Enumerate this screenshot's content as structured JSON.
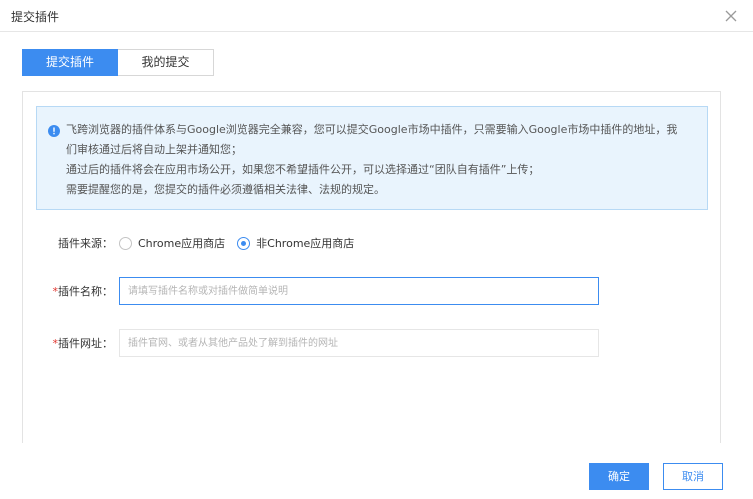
{
  "dialog": {
    "title": "提交插件"
  },
  "tabs": [
    {
      "label": "提交插件",
      "active": true
    },
    {
      "label": "我的提交",
      "active": false
    }
  ],
  "notice": {
    "lines": [
      "飞跨浏览器的插件体系与Google浏览器完全兼容，您可以提交Google市场中插件，只需要输入Google市场中插件的地址，我",
      "们审核通过后将自动上架并通知您；",
      "通过后的插件将会在应用市场公开，如果您不希望插件公开，可以选择通过“团队自有插件”上传；",
      "需要提醒您的是，您提交的插件必须遵循相关法律、法规的规定。"
    ]
  },
  "form": {
    "source_label": "插件来源：",
    "source_options": [
      {
        "label": "Chrome应用商店",
        "checked": false
      },
      {
        "label": "非Chrome应用商店",
        "checked": true
      }
    ],
    "required_mark": "*",
    "name_label": "插件名称：",
    "name_value": "",
    "name_placeholder": "请填写插件名称或对插件做简单说明",
    "url_label": "插件网址：",
    "url_value": "",
    "url_placeholder": "插件官网、或者从其他产品处了解到插件的网址"
  },
  "buttons": {
    "ok": "确定",
    "cancel": "取消"
  },
  "colors": {
    "accent": "#3c8cf0",
    "notice_bg": "#e9f4fd",
    "required": "#e0342e"
  },
  "icons": {
    "close": "close-icon",
    "info": "info-icon"
  }
}
